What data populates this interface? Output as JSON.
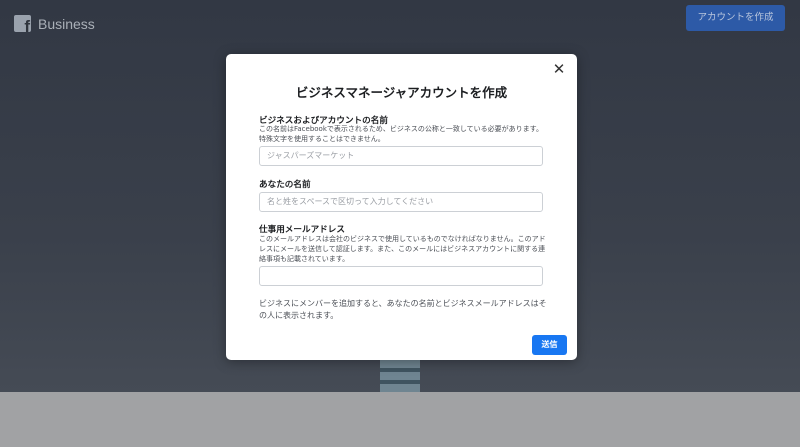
{
  "header": {
    "brand": "Business",
    "logo_icon": "facebook-icon",
    "logo_letter": "f",
    "create_account_button": "アカウントを作成"
  },
  "dialog": {
    "title": "ビジネスマネージャアカウントを作成",
    "close_icon": "close-icon",
    "close_glyph": "✕",
    "business_name": {
      "label": "ビジネスおよびアカウントの名前",
      "help": "この名前はFacebookで表示されるため、ビジネスの公称と一致している必要があります。特殊文字を使用することはできません。",
      "value": "",
      "placeholder": "ジャスパーズマーケット"
    },
    "your_name": {
      "label": "あなたの名前",
      "value": "",
      "placeholder": "名と姓をスペースで区切って入力してください"
    },
    "work_email": {
      "label": "仕事用メールアドレス",
      "help": "このメールアドレスは会社のビジネスで使用しているものでなければなりません。このアドレスにメールを送信して認証します。また、このメールにはビジネスアカウントに関する連絡事項も記載されています。",
      "value": "",
      "placeholder": ""
    },
    "note": "ビジネスにメンバーを追加すると、あなたの名前とビジネスメールアドレスはその人に表示されます。",
    "submit_button": "送信"
  },
  "colors": {
    "primary": "#1877f2",
    "header_button": "#2d5aa7",
    "background": "#323844",
    "floor": "#a1a2a4"
  }
}
